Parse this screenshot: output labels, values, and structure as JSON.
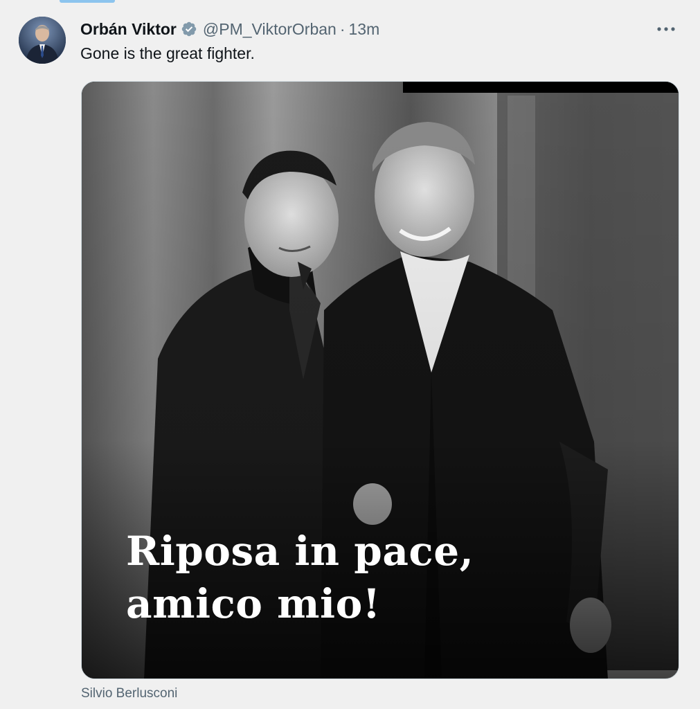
{
  "author": {
    "display_name": "Orbán Viktor",
    "handle": "@PM_ViktorOrban",
    "separator": "·",
    "time_ago": "13m",
    "verified": true,
    "avatar_icon": "avatar"
  },
  "tweet": {
    "text": "Gone is the great fighter."
  },
  "media": {
    "overlay_line_1": "Riposa in pace,",
    "overlay_line_2": "amico mio!"
  },
  "caption": {
    "tag": "Silvio Berlusconi"
  },
  "icons": {
    "verified": "verified-badge-icon",
    "more": "more-options-icon"
  },
  "colors": {
    "background": "#f0f0f0",
    "text_primary": "#0f1419",
    "text_secondary": "#536471",
    "verified_badge": "#829aab"
  }
}
